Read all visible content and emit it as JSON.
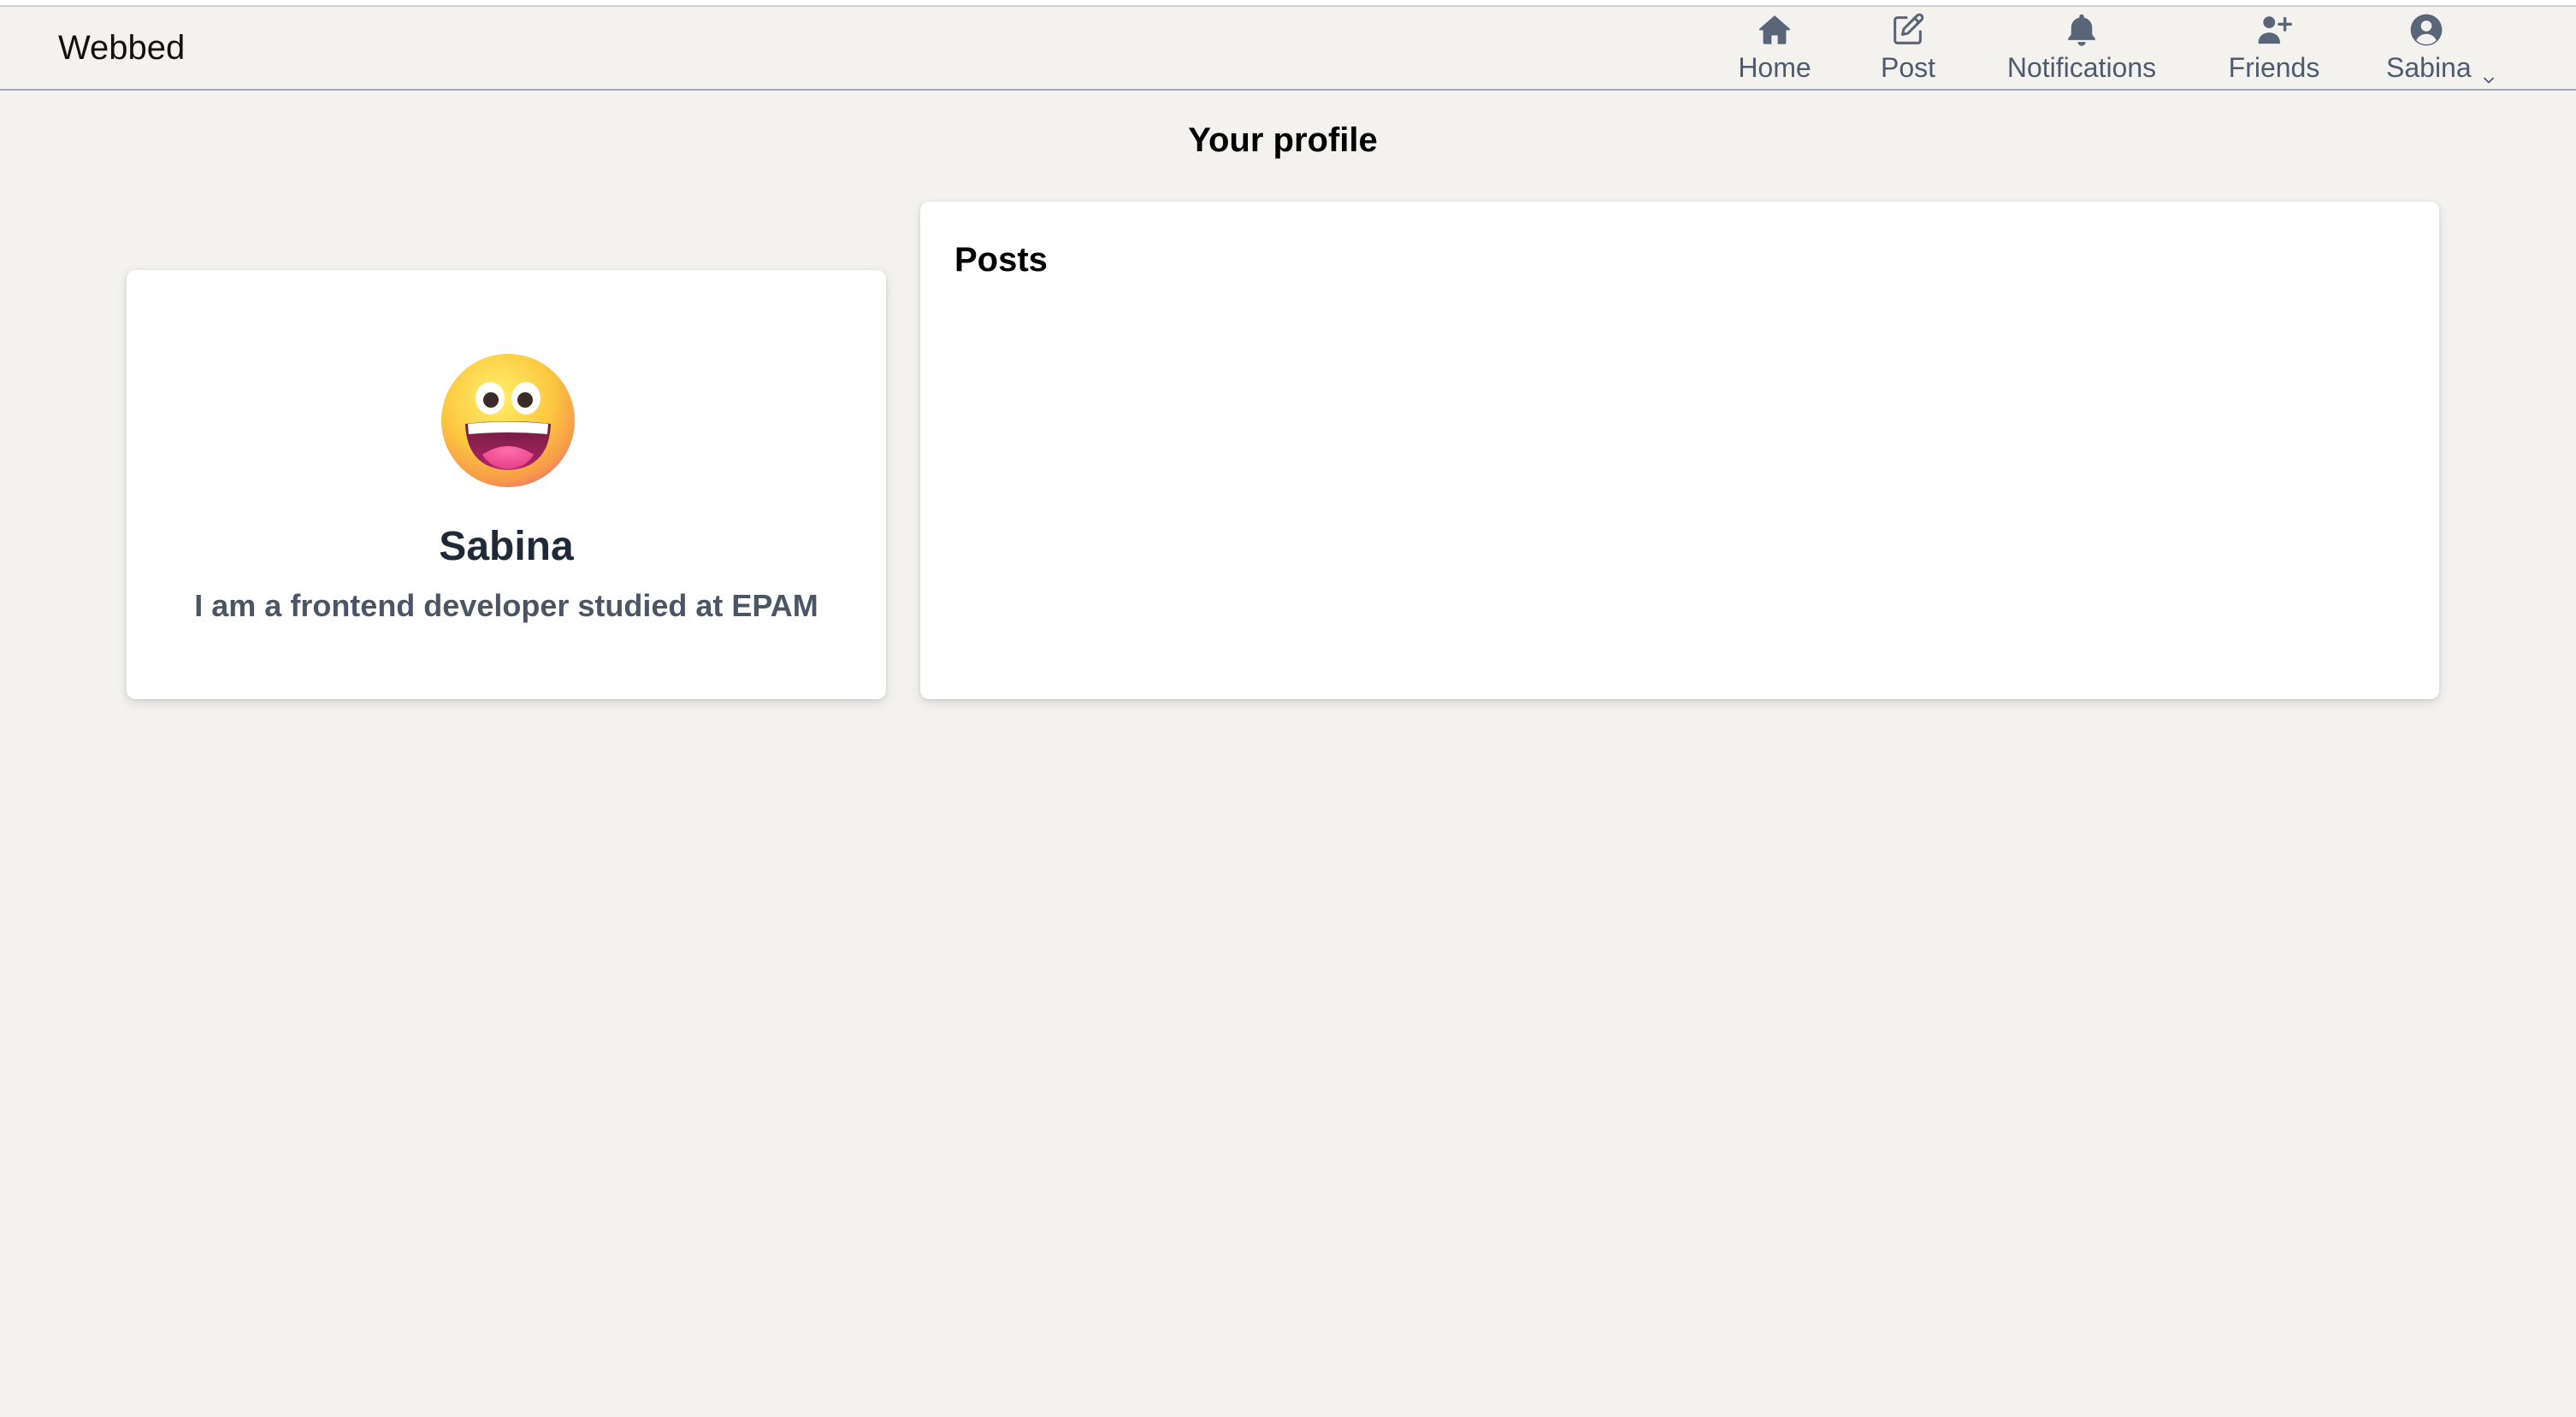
{
  "app": {
    "brand": "Webbed"
  },
  "nav": {
    "items": [
      {
        "label": "Home",
        "icon": "home-icon"
      },
      {
        "label": "Post",
        "icon": "edit-icon"
      },
      {
        "label": "Notifications",
        "icon": "bell-icon"
      },
      {
        "label": "Friends",
        "icon": "user-plus-icon"
      },
      {
        "label": "Sabina",
        "icon": "user-circle-icon",
        "dropdown": true
      }
    ]
  },
  "page": {
    "title": "Your profile"
  },
  "profile": {
    "name": "Sabina",
    "bio": "I am a frontend developer studied at EPAM",
    "avatar_icon": "grinning-face-emoji"
  },
  "posts": {
    "heading": "Posts"
  },
  "colors": {
    "background": "#f3f2ef",
    "nav_icon": "#5b6578",
    "nav_text": "#4f5b6d",
    "card": "#ffffff"
  }
}
